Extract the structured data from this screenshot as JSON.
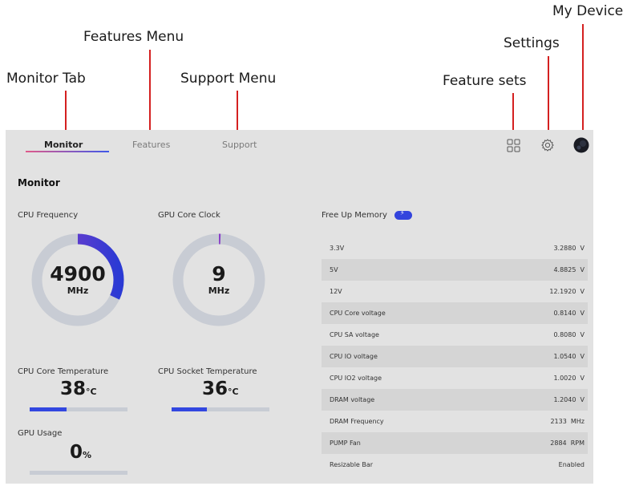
{
  "callouts": {
    "monitor_tab": "Monitor Tab",
    "features_menu": "Features Menu",
    "support_menu": "Support Menu",
    "feature_sets": "Feature sets",
    "settings": "Settings",
    "my_device": "My Device"
  },
  "tabs": {
    "monitor": "Monitor",
    "features": "Features",
    "support": "Support"
  },
  "section_title": "Monitor",
  "gauges": {
    "cpu_frequency": {
      "label": "CPU Frequency",
      "value": "4900",
      "unit": "MHz",
      "fill_fraction": 0.32
    },
    "gpu_core_clock": {
      "label": "GPU Core Clock",
      "value": "9",
      "unit": "MHz",
      "fill_fraction": 0.005
    }
  },
  "temps": {
    "cpu_core": {
      "label": "CPU Core Temperature",
      "value": "38",
      "unit": "°C",
      "fill_fraction": 0.38
    },
    "cpu_socket": {
      "label": "CPU Socket Temperature",
      "value": "36",
      "unit": "°C",
      "fill_fraction": 0.36
    },
    "gpu_usage": {
      "label": "GPU Usage",
      "value": "0",
      "unit": "%",
      "fill_fraction": 0
    }
  },
  "free_up_memory": "Free Up Memory",
  "voltages": [
    {
      "name": "3.3V",
      "value": "3.2880  V"
    },
    {
      "name": "5V",
      "value": "4.8825  V"
    },
    {
      "name": "12V",
      "value": "12.1920  V"
    },
    {
      "name": "CPU Core voltage",
      "value": "0.8140  V"
    },
    {
      "name": "CPU SA voltage",
      "value": "0.8080  V"
    },
    {
      "name": "CPU IO voltage",
      "value": "1.0540  V"
    },
    {
      "name": "CPU IO2 voltage",
      "value": "1.0020  V"
    },
    {
      "name": "DRAM voltage",
      "value": "1.2040  V"
    },
    {
      "name": "DRAM Frequency",
      "value": "2133  MHz"
    },
    {
      "name": "PUMP Fan",
      "value": "2884  RPM"
    },
    {
      "name": "Resizable Bar",
      "value": "Enabled"
    }
  ],
  "colors": {
    "accent": "#3247e0",
    "accent_purple": "#8a3fc8",
    "track": "#c8ccd4",
    "callout_line": "#d42020"
  }
}
